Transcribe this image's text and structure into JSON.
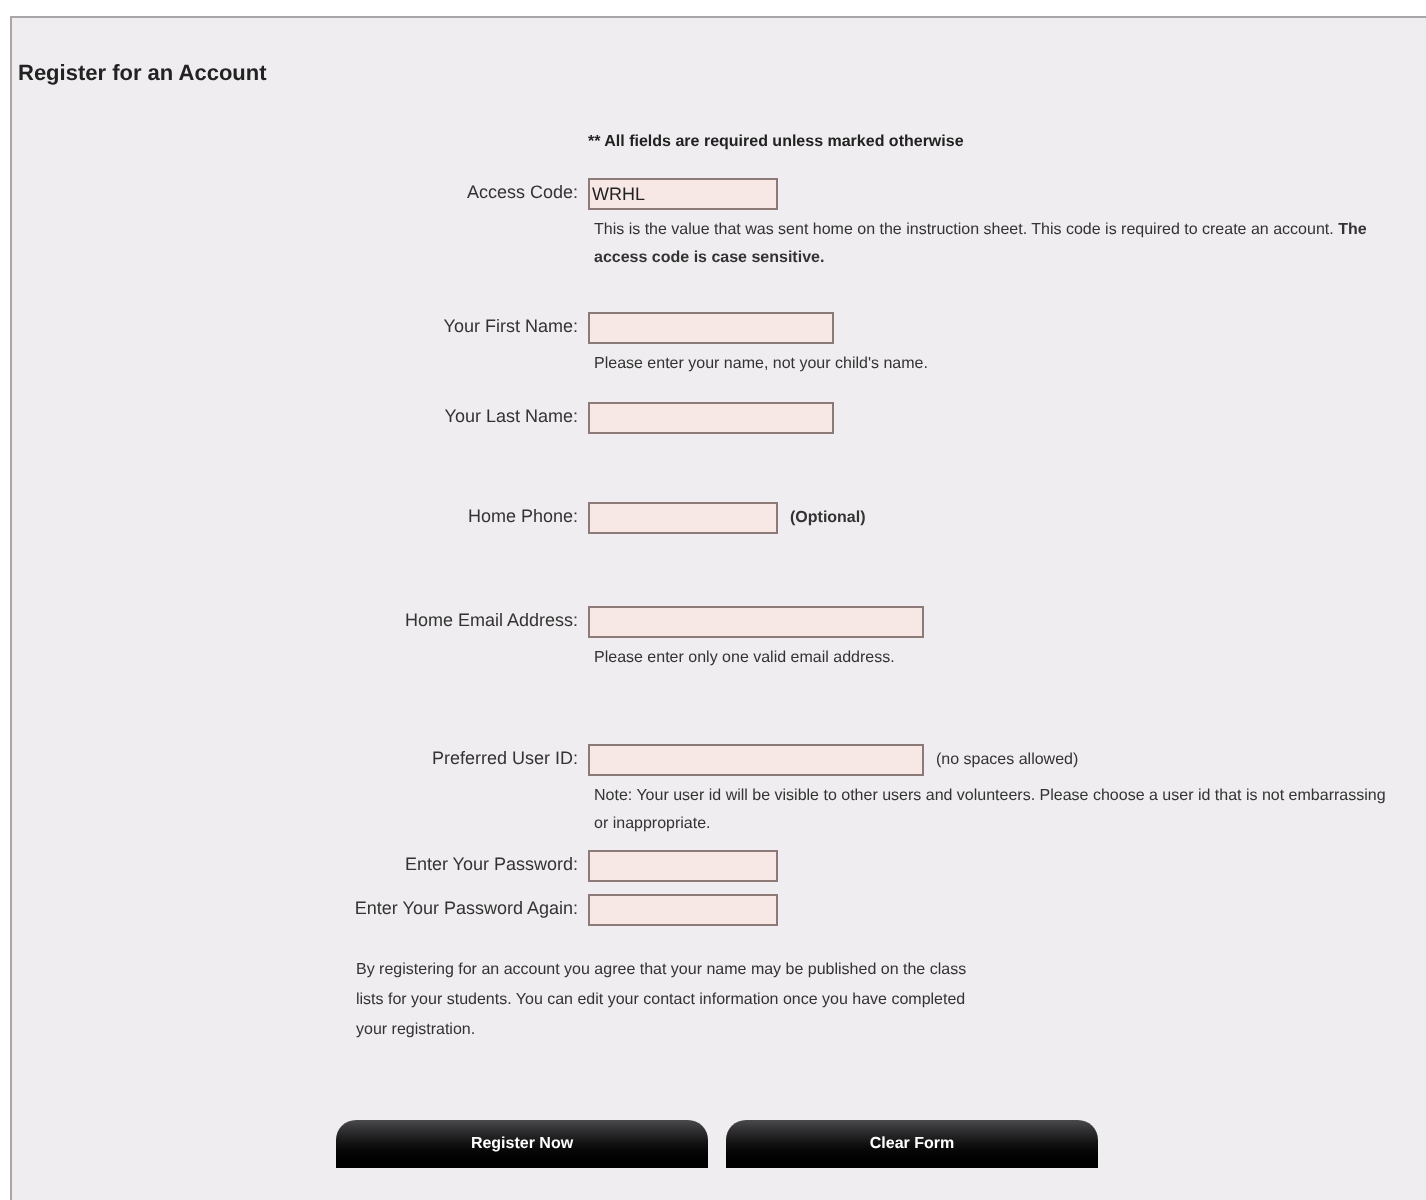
{
  "title": "Register for an Account",
  "required_note": "** All fields are required unless marked otherwise",
  "fields": [
    {
      "label": "Access Code:",
      "value": "WRHL",
      "note": "This is the value that was sent home on the instruction sheet. This code is required to create an account. **The access code is case sensitive.**"
    },
    {
      "label": "Your First Name:",
      "note": "Please enter your name, not your child's name."
    },
    {
      "label": "Your Last Name:"
    },
    {
      "label": "Home Phone:",
      "suffix": "(Optional)",
      "suffix_bold": true
    },
    {
      "label": "Home Email Address:",
      "note": "Please enter only one valid email address."
    },
    {
      "label": "Preferred User ID:",
      "suffix": "(no spaces allowed)",
      "suffix_bold": false,
      "note": "Note: Your user id will be visible to other users and volunteers. Please choose a user id that is not embarrassing or inappropriate."
    },
    {
      "label": "Enter Your Password:"
    },
    {
      "label": "Enter Your Password Again:"
    }
  ],
  "agreement": "By registering for an account you agree that your name may be published on the class lists for your students. You can edit your contact information once you have completed your registration.",
  "buttons": [
    "Register Now",
    "Clear Form"
  ]
}
